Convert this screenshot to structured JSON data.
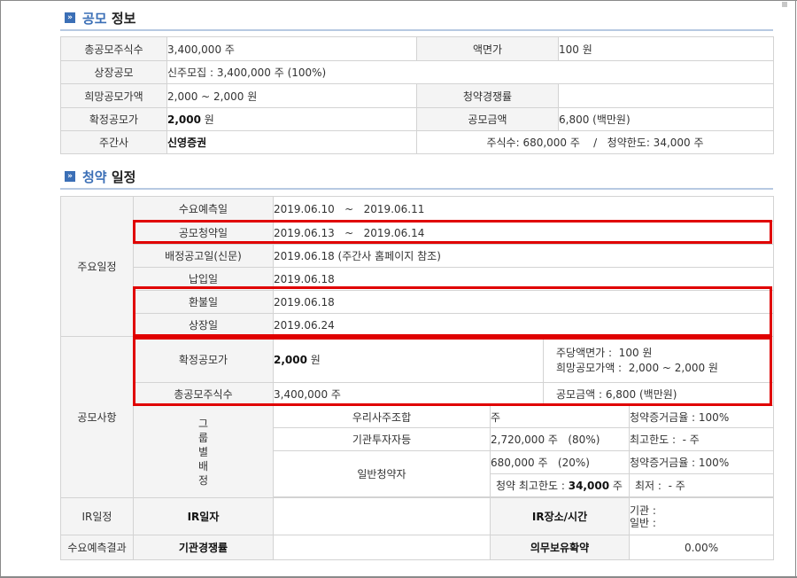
{
  "offering_info": {
    "title_accent": "공모",
    "title_rest": " 정보",
    "rows": [
      {
        "l1": "총공모주식수",
        "v1": "3,400,000 주",
        "l2": "액면가",
        "v2": "100 원"
      },
      {
        "l1": "상장공모",
        "v1": "신주모집 : 3,400,000 주 (100%)"
      },
      {
        "l1": "희망공모가액",
        "v1": "2,000 ~ 2,000 원",
        "l2": "청약경쟁률",
        "v2": ""
      },
      {
        "l1": "확정공모가",
        "v1_num": "2,000",
        "v1_unit": " 원",
        "l2": "공모금액",
        "v2": "6,800 (백만원)"
      },
      {
        "l1": "주간사",
        "v1": "신영증권",
        "v2": "주식수: 680,000 주    /   청약한도: 34,000 주"
      }
    ]
  },
  "subscription": {
    "title_accent": "청약",
    "title_rest": " 일정",
    "main_schedule_label": "주요일정",
    "schedule": [
      {
        "label": "수요예측일",
        "value": "2019.06.10   ~   2019.06.11"
      },
      {
        "label": "공모청약일",
        "value": "2019.06.13   ~   2019.06.14"
      },
      {
        "label": "배정공고일(신문)",
        "value": "2019.06.18 (주간사 홈페이지 참조)"
      },
      {
        "label": "납입일",
        "value": "2019.06.18"
      },
      {
        "label": "환불일",
        "value": "2019.06.18"
      },
      {
        "label": "상장일",
        "value": "2019.06.24"
      }
    ],
    "offering_matters_label": "공모사항",
    "fixed_price_label": "확정공모가",
    "fixed_price_num": "2,000",
    "fixed_price_unit": " 원",
    "par_value": "주당액면가 :  100 원",
    "hope_price": "희망공모가액 :  2,000 ~ 2,000 원",
    "total_shares_label": "총공모주식수",
    "total_shares": "3,400,000 주",
    "offering_amount": "공모금액 : 6,800 (백만원)",
    "group_label": "그\n룹\n별\n배\n정",
    "groups": {
      "employee": {
        "name": "우리사주조합",
        "shares": "주",
        "note": "청약증거금율 : 100%"
      },
      "institutional": {
        "name": "기관투자자등",
        "shares": "2,720,000 주   (80%)",
        "note": "최고한도 :  - 주"
      },
      "retail": {
        "name": "일반청약자",
        "shares": "680,000 주   (20%)",
        "note": "청약증거금율 : 100%",
        "limit_label": "청약 최고한도 : ",
        "limit_num": "34,000",
        "limit_unit": " 주",
        "min": "최저 :  - 주"
      }
    },
    "ir_label": "IR일정",
    "ir_date_label": "IR일자",
    "ir_date_value": "",
    "ir_place_label": "IR장소/시간",
    "ir_inst": "기관 :",
    "ir_retail": "일반 :",
    "demand_label": "수요예측결과",
    "inst_competition_label": "기관경쟁률",
    "inst_competition_value": "",
    "lockup_label": "의무보유확약",
    "lockup_value": "0.00%"
  }
}
